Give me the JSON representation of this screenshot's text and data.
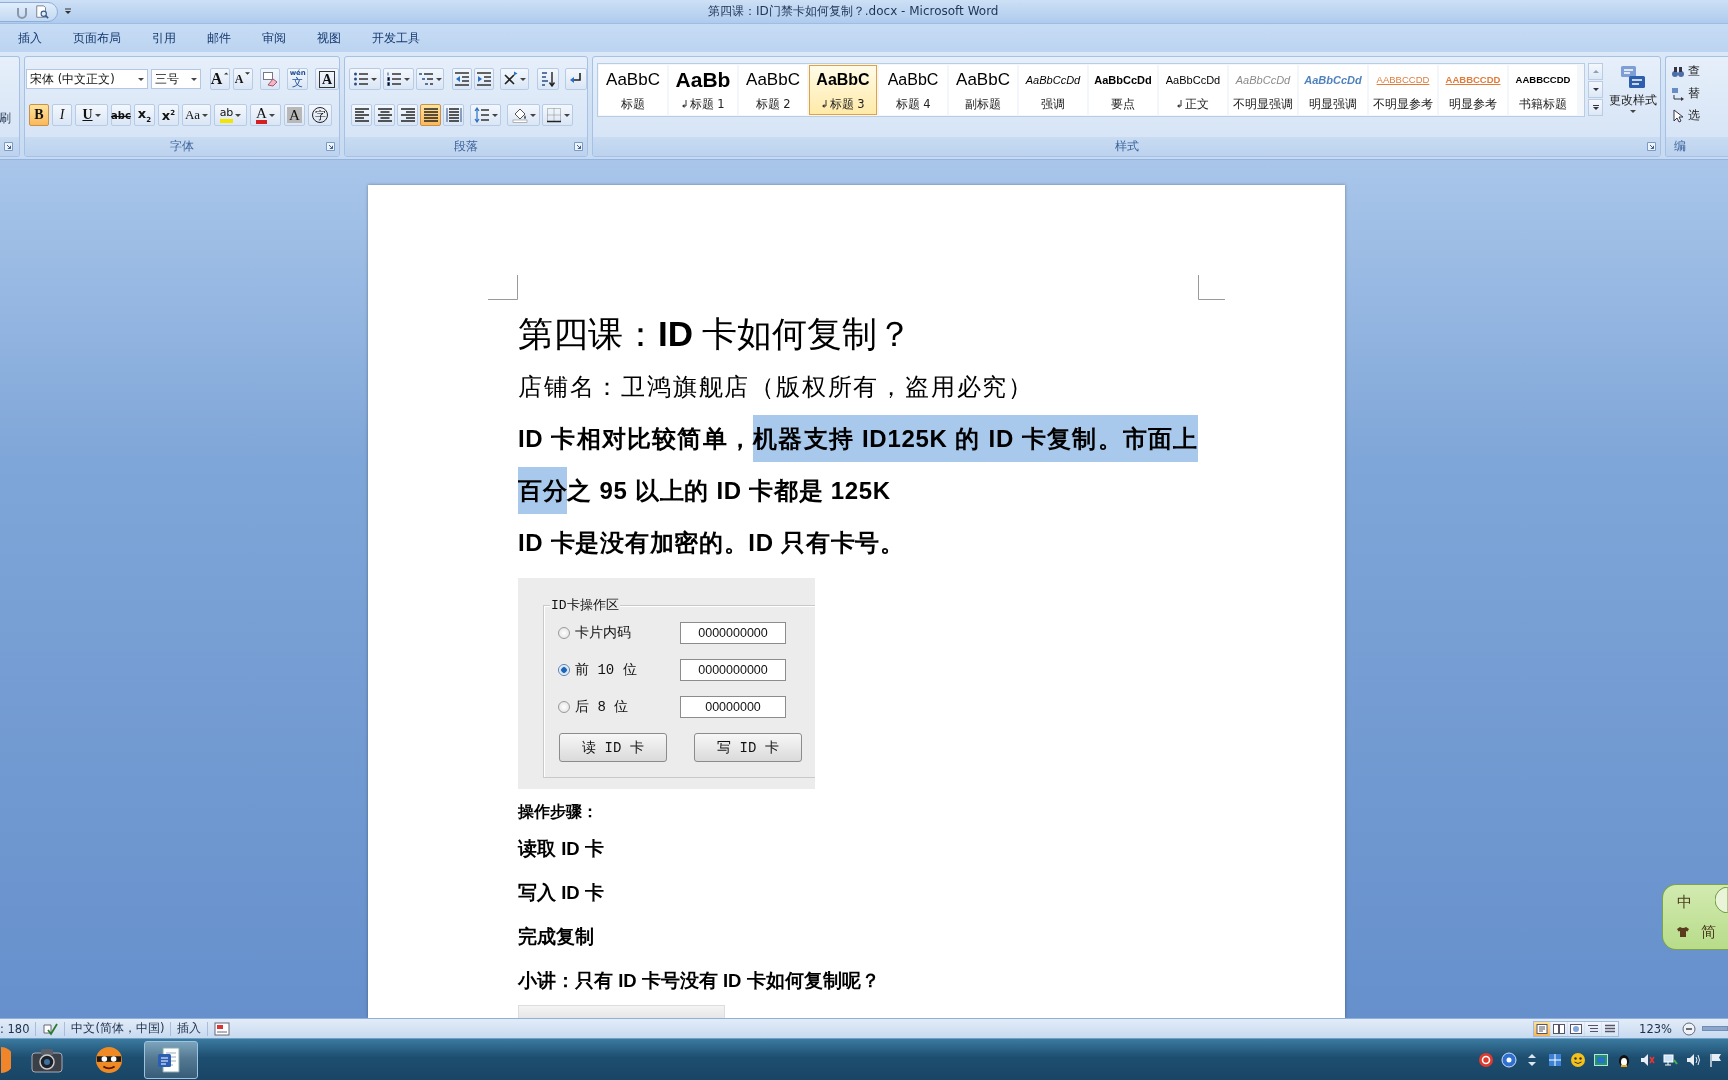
{
  "window": {
    "title": "第四课：ID门禁卡如何复制？.docx - Microsoft Word"
  },
  "ribbon_tabs": [
    {
      "label": "插入",
      "selected": false
    },
    {
      "label": "页面布局",
      "selected": false
    },
    {
      "label": "引用",
      "selected": false
    },
    {
      "label": "邮件",
      "selected": false
    },
    {
      "label": "审阅",
      "selected": false
    },
    {
      "label": "视图",
      "selected": false
    },
    {
      "label": "开发工具",
      "selected": false
    }
  ],
  "ribbon": {
    "clipboard_group": {
      "item": "刷"
    },
    "font_group": {
      "label": "字体",
      "font_name": "宋体 (中文正文)",
      "font_size": "三号",
      "row_1": [
        {
          "kind": "grow",
          "label": "A"
        },
        {
          "kind": "shrink",
          "label": "A"
        },
        {
          "kind": "clear"
        },
        {
          "kind": "phonetic",
          "label": "文",
          "ruby": "wén"
        },
        {
          "kind": "border",
          "label": "A"
        }
      ],
      "row_2": [
        {
          "kind": "bold",
          "label": "B",
          "on": true
        },
        {
          "kind": "italic",
          "label": "I",
          "on": false
        },
        {
          "kind": "underline",
          "label": "U",
          "on": false
        },
        {
          "kind": "strike",
          "label": "abc",
          "on": false
        },
        {
          "kind": "subscript",
          "label": "x$_{2}$",
          "on": false
        },
        {
          "kind": "superscript",
          "label": "x$^{2}$",
          "on": false
        },
        {
          "kind": "case",
          "label": "Aa",
          "on": false
        },
        {
          "kind": "highlight",
          "label": "ab",
          "on": false
        },
        {
          "kind": "color",
          "label": "A",
          "on": false
        },
        {
          "kind": "shading",
          "label": "A",
          "on": false
        },
        {
          "kind": "enclose",
          "label": "字",
          "on": false
        }
      ]
    },
    "paragraph_group": {
      "label": "段落",
      "alignments": [
        {
          "kind": "left",
          "selected": false
        },
        {
          "kind": "center",
          "selected": false
        },
        {
          "kind": "right",
          "selected": false
        },
        {
          "kind": "justify",
          "selected": true
        },
        {
          "kind": "distributed",
          "selected": false
        }
      ]
    },
    "styles_group": {
      "label": "样式",
      "styles": [
        {
          "kind": "title",
          "preview": "AaBbC",
          "label": "标题",
          "paragraph_mark": false,
          "selected": false
        },
        {
          "kind": "heading_1",
          "preview": "AaBb",
          "label": "标题 1",
          "paragraph_mark": true,
          "selected": false
        },
        {
          "kind": "heading_2",
          "preview": "AaBbC",
          "label": "标题 2",
          "paragraph_mark": false,
          "selected": false
        },
        {
          "kind": "heading_3",
          "preview": "AaBbC",
          "label": "标题 3",
          "paragraph_mark": true,
          "selected": true
        },
        {
          "kind": "heading_4",
          "preview": "AaBbC",
          "label": "标题 4",
          "paragraph_mark": false,
          "selected": false
        },
        {
          "kind": "subtitle",
          "preview": "AaBbC",
          "label": "副标题",
          "paragraph_mark": false,
          "selected": false
        },
        {
          "kind": "emphasis",
          "preview": "AaBbCcDd",
          "label": "强调",
          "paragraph_mark": false,
          "selected": false
        },
        {
          "kind": "strong",
          "preview": "AaBbCcDd",
          "label": "要点",
          "paragraph_mark": false,
          "selected": false
        },
        {
          "kind": "normal",
          "preview": "AaBbCcDd",
          "label": "正文",
          "paragraph_mark": true,
          "selected": false
        },
        {
          "kind": "subtle_emphasis",
          "preview": "AaBbCcDd",
          "label": "不明显强调",
          "paragraph_mark": false,
          "selected": false
        },
        {
          "kind": "intense_emphasis",
          "preview": "AaBbCcDd",
          "label": "明显强调",
          "paragraph_mark": false,
          "selected": false
        },
        {
          "kind": "subtle_reference",
          "preview": "AABBCCDD",
          "label": "不明显参考",
          "paragraph_mark": false,
          "selected": false
        },
        {
          "kind": "intense_reference",
          "preview": "AABBCCDD",
          "label": "明显参考",
          "paragraph_mark": false,
          "selected": false
        },
        {
          "kind": "book_title",
          "preview": "AABBCCDD",
          "label": "书籍标题",
          "paragraph_mark": false,
          "selected": false
        }
      ],
      "change_styles": "更改样式"
    },
    "editing_group": {
      "label": "编",
      "items": [
        "查",
        "替",
        "选"
      ]
    }
  },
  "document": {
    "paragraphs": [
      {
        "kind": "title",
        "text": "第四课：**ID** 卡如何复制？"
      },
      {
        "kind": "plain",
        "text": "店铺名：卫鸿旗舰店（版权所有，盗用必究）"
      },
      {
        "kind": "bold",
        "runs": [
          {
            "text": "ID 卡相对比较简单，",
            "selected": false
          },
          {
            "text": "机器支持 ID125K 的 ID 卡复制。市面上百分",
            "selected": true
          },
          {
            "text": "之 95 以上的 ID 卡都是 125K",
            "selected": false
          }
        ]
      },
      {
        "kind": "bold",
        "runs": [
          {
            "text": "ID 卡是没有加密的。ID 只有卡号。",
            "selected": false
          }
        ]
      },
      {
        "kind": "dialog",
        "group_label": "ID卡操作区",
        "options": [
          {
            "label": "卡片内码",
            "selected": false,
            "value": "0000000000"
          },
          {
            "label": "前 10 位",
            "selected": true,
            "value": "0000000000"
          },
          {
            "label": "后 8 位",
            "selected": false,
            "value": "00000000"
          }
        ],
        "buttons": [
          "读 ID 卡",
          "写 ID 卡"
        ]
      },
      {
        "kind": "caption",
        "text": "操作步骤："
      },
      {
        "kind": "step",
        "text": "读取 ID 卡"
      },
      {
        "kind": "step",
        "text": "写入 ID 卡"
      },
      {
        "kind": "step",
        "text": "完成复制"
      },
      {
        "kind": "step",
        "text": "小讲：只有 ID 卡号没有 ID 卡如何复制呢？"
      },
      {
        "kind": "image"
      }
    ]
  },
  "ime_bar": {
    "mode": "中",
    "script": "简"
  },
  "status_bar": {
    "words": ": 180",
    "language": "中文(简体，中国)",
    "mode": "插入",
    "views": [
      {
        "kind": "print_layout",
        "selected": true
      },
      {
        "kind": "full_screen",
        "selected": false
      },
      {
        "kind": "web",
        "selected": false
      },
      {
        "kind": "outline",
        "selected": false
      },
      {
        "kind": "draft",
        "selected": false
      }
    ],
    "zoom": "123%"
  },
  "taskbar": {
    "apps": [
      {
        "kind": "orb",
        "selected": false
      },
      {
        "kind": "camera",
        "selected": false
      },
      {
        "kind": "mascot",
        "selected": false
      },
      {
        "kind": "word",
        "selected": true
      }
    ]
  }
}
